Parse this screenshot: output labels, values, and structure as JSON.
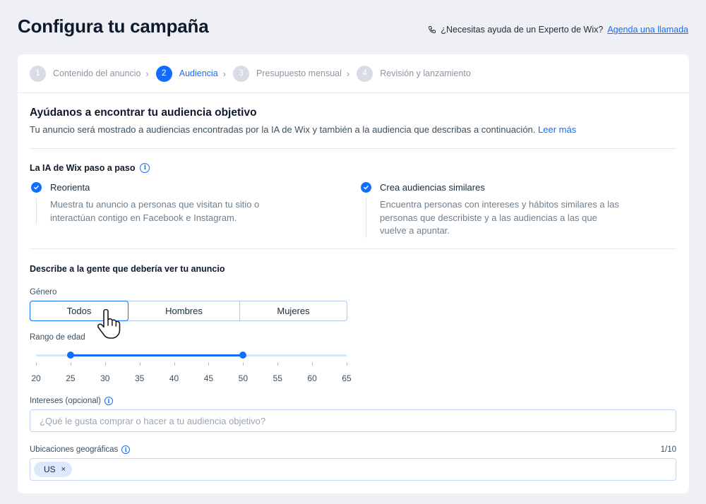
{
  "page": {
    "title": "Configura tu campaña",
    "help_text": "¿Necesitas ayuda de un Experto de Wix?",
    "help_link": "Agenda una llamada"
  },
  "stepper": {
    "steps": [
      {
        "num": "1",
        "label": "Contenido del anuncio",
        "state": "done"
      },
      {
        "num": "2",
        "label": "Audiencia",
        "state": "active"
      },
      {
        "num": "3",
        "label": "Presupuesto mensual",
        "state": "todo"
      },
      {
        "num": "4",
        "label": "Revisión y lanzamiento",
        "state": "todo"
      }
    ]
  },
  "audience": {
    "title": "Ayúdanos a encontrar tu audiencia objetivo",
    "subtitle": "Tu anuncio será mostrado a audiencias encontradas por la IA de Wix y también a la audiencia que describas a continuación.",
    "learn_more": "Leer más"
  },
  "ai": {
    "title": "La IA de Wix paso a paso",
    "features": [
      {
        "title": "Reorienta",
        "desc": "Muestra tu anuncio a personas que visitan tu sitio o interactúan contigo en Facebook e Instagram."
      },
      {
        "title": "Crea audiencias similares",
        "desc": "Encuentra personas con intereses y hábitos similares a las personas que describiste y a las audiencias a las que vuelve a apuntar."
      }
    ]
  },
  "describe": {
    "title": "Describe a la gente que debería ver tu anuncio",
    "gender_label": "Género",
    "gender_options": [
      "Todos",
      "Hombres",
      "Mujeres"
    ],
    "gender_selected": "Todos",
    "age_label": "Rango de edad",
    "age_ticks": [
      20,
      25,
      30,
      35,
      40,
      45,
      50,
      55,
      60,
      65
    ],
    "age_min": 20,
    "age_max": 65,
    "age_selected": [
      25,
      50
    ],
    "interests_label": "Intereses (opcional)",
    "interests_placeholder": "¿Qué le gusta comprar o hacer a tu audiencia objetivo?",
    "locations_label": "Ubicaciones geográficas",
    "locations_count": "1/10",
    "locations": [
      "US"
    ]
  },
  "colors": {
    "accent": "#116dff",
    "background": "#eef0f5",
    "text": "#162d3d"
  }
}
